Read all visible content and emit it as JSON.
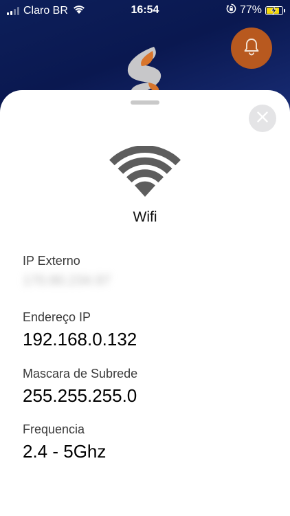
{
  "status_bar": {
    "carrier": "Claro BR",
    "time": "16:54",
    "battery_percent": "77%",
    "battery_level": 0.77,
    "icons": [
      "signal-icon",
      "wifi-status-icon",
      "orientation-lock-icon",
      "battery-charging-icon"
    ]
  },
  "header": {
    "logo_icon": "brand-logo-icon",
    "bell_icon": "bell-icon",
    "accent_color": "#b8591f",
    "background_color": "#0d1f5a"
  },
  "sheet": {
    "close_icon": "close-icon",
    "wifi_icon": "wifi-icon",
    "title": "Wifi",
    "fields": [
      {
        "label": "IP Externo",
        "value": "170.80.234.97",
        "obscured": true
      },
      {
        "label": "Endereço IP",
        "value": "192.168.0.132"
      },
      {
        "label": "Mascara de Subrede",
        "value": "255.255.255.0"
      },
      {
        "label": "Frequencia",
        "value": "2.4 - 5Ghz"
      }
    ]
  }
}
